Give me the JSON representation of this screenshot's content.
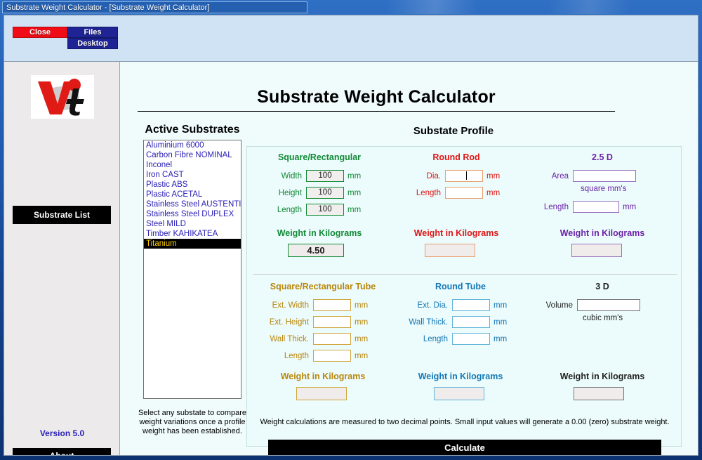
{
  "window": {
    "title": "Substrate Weight Calculator - [Substrate Weight Calculator]"
  },
  "toolbar": {
    "close_label": "Close",
    "files_label": "Files",
    "desktop_label": "Desktop"
  },
  "sidebar": {
    "logo_name": "vt-logo",
    "substrate_list_label": "Substrate List",
    "version_label": "Version 5.0",
    "about_label": "About"
  },
  "main": {
    "page_title": "Substrate Weight Calculator",
    "active_substrates_heading": "Active Substrates",
    "profile_heading": "Substate Profile",
    "list_note": "Select any substate to compare weight variations once a profile weight has been established.",
    "footer_note": "Weight calculations are measured to two decimal points. Small input values will generate a 0.00 (zero) substrate weight.",
    "calculate_label": "Calculate"
  },
  "substrates": {
    "items": [
      "Aluminium 6000",
      "Carbon Fibre NOMINAL",
      "Inconel",
      "Iron CAST",
      "Plastic ABS",
      "Plastic ACETAL",
      "Stainless Steel AUSTENTIC",
      "Stainless Steel DUPLEX",
      "Steel MILD",
      "Timber KAHIKATEA",
      "Titanium"
    ],
    "selected": "Titanium",
    "selected_index": 10
  },
  "sections": {
    "square_rect": {
      "title": "Square/Rectangular",
      "color": "#128a36",
      "fields": [
        {
          "label": "Width",
          "value": "100",
          "unit": "mm"
        },
        {
          "label": "Height",
          "value": "100",
          "unit": "mm"
        },
        {
          "label": "Length",
          "value": "100",
          "unit": "mm"
        }
      ],
      "weight_label": "Weight in Kilograms",
      "weight_value": "4.50"
    },
    "round_rod": {
      "title": "Round Rod",
      "color": "#e11515",
      "fields": [
        {
          "label": "Dia.",
          "value": "",
          "unit": "mm"
        },
        {
          "label": "Length",
          "value": "",
          "unit": "mm"
        }
      ],
      "weight_label": "Weight in Kilograms",
      "weight_value": ""
    },
    "two_five_d": {
      "title": "2.5 D",
      "color": "#6b23a8",
      "area_label": "Area",
      "area_value": "",
      "area_unit": "square mm's",
      "length_label": "Length",
      "length_value": "",
      "length_unit": "mm",
      "weight_label": "Weight in Kilograms",
      "weight_value": ""
    },
    "square_rect_tube": {
      "title": "Square/Rectangular Tube",
      "color": "#b8860b",
      "fields": [
        {
          "label": "Ext. Width",
          "value": "",
          "unit": "mm"
        },
        {
          "label": "Ext. Height",
          "value": "",
          "unit": "mm"
        },
        {
          "label": "Wall Thick.",
          "value": "",
          "unit": "mm"
        },
        {
          "label": "Length",
          "value": "",
          "unit": "mm"
        }
      ],
      "weight_label": "Weight in Kilograms",
      "weight_value": ""
    },
    "round_tube": {
      "title": "Round Tube",
      "color": "#1378b8",
      "fields": [
        {
          "label": "Ext. Dia.",
          "value": "",
          "unit": "mm"
        },
        {
          "label": "Wall Thick.",
          "value": "",
          "unit": "mm"
        },
        {
          "label": "Length",
          "value": "",
          "unit": "mm"
        }
      ],
      "weight_label": "Weight in Kilograms",
      "weight_value": ""
    },
    "three_d": {
      "title": "3 D",
      "color": "#222222",
      "volume_label": "Volume",
      "volume_value": "",
      "volume_unit": "cubic mm's",
      "weight_label": "Weight in Kilograms",
      "weight_value": ""
    }
  }
}
